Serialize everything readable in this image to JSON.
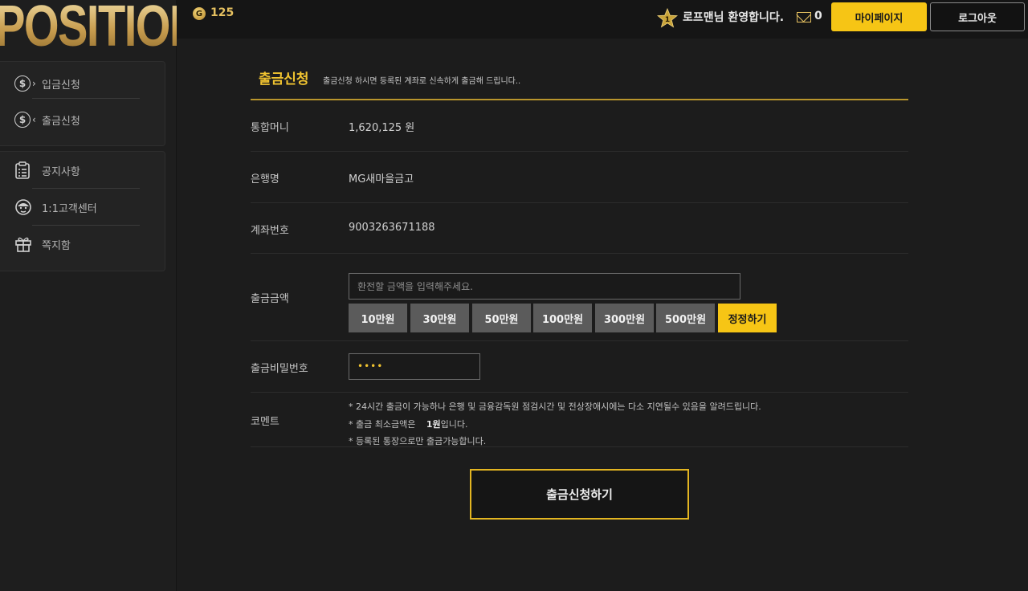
{
  "brand": {
    "logo_text": "POSITION"
  },
  "sidebar": {
    "items": [
      {
        "label": "입금신청",
        "icon": "deposit-icon"
      },
      {
        "label": "출금신청",
        "icon": "withdraw-icon"
      },
      {
        "label": "공지사항",
        "icon": "notice-icon"
      },
      {
        "label": "1:1고객센터",
        "icon": "support-icon"
      },
      {
        "label": "쪽지함",
        "icon": "gift-icon"
      }
    ]
  },
  "topbar": {
    "coin_icon_letter": "G",
    "coin_balance": "125",
    "level": "1",
    "welcome": "로프맨님 환영합니다.",
    "message_count": "0",
    "mypage_label": "마이페이지",
    "logout_label": "로그아웃"
  },
  "page": {
    "title": "출금신청",
    "subtitle": "출금신청 하시면 등록된 계좌로 신속하게 출금해 드립니다..",
    "rows": {
      "money_label": "통합머니",
      "money_value": "1,620,125 원",
      "bank_label": "은행명",
      "bank_value": "MG새마을금고",
      "account_label": "계좌번호",
      "account_value": "9003263671188",
      "amount_label": "출금금액",
      "amount_placeholder": "환전할 금액을 입력해주세요.",
      "password_label": "출금비밀번호",
      "password_value": "••••",
      "comment_label": "코멘트"
    },
    "quick_amounts": [
      "10만원",
      "30만원",
      "50만원",
      "100만원",
      "300만원",
      "500만원"
    ],
    "reset_label": "정정하기",
    "comments": {
      "line1": "* 24시간 출금이 가능하나 은행 및 금융감독원 점검시간 및 전상장애시에는 다소 지연될수 있음을 알려드립니다.",
      "line2_prefix": "* 출금 최소금액은",
      "line2_amount": "1원",
      "line2_suffix": "입니다.",
      "line3": "* 등록된 통장으로만 출금가능합니다."
    },
    "submit_label": "출금신청하기"
  },
  "colors": {
    "accent": "#f6c515",
    "gold": "#e5c060",
    "background": "#1c1c1c"
  }
}
